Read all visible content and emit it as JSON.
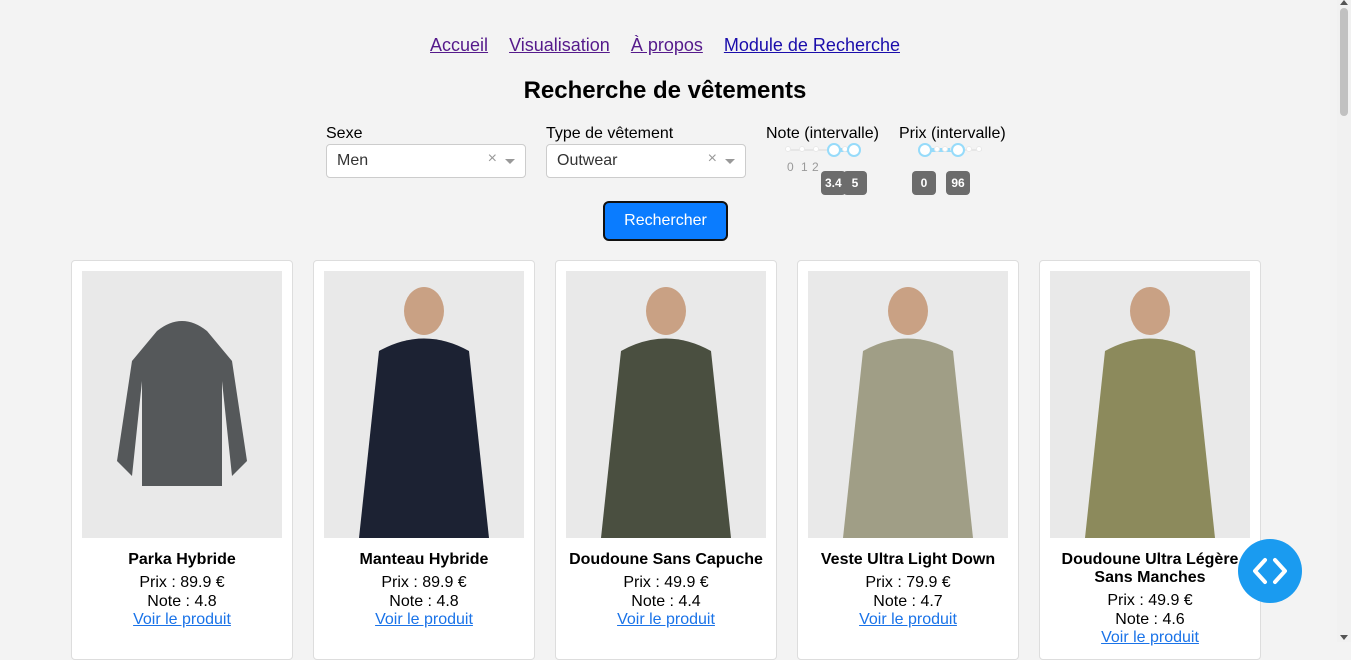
{
  "nav": [
    "Accueil",
    "Visualisation",
    "À propos",
    "Module de Recherche"
  ],
  "title": "Recherche de vêtements",
  "filters": {
    "sexe": {
      "label": "Sexe",
      "value": "Men"
    },
    "type": {
      "label": "Type de vêtement",
      "value": "Outwear"
    },
    "note": {
      "label": "Note (intervalle)",
      "marks": [
        "0",
        "1",
        "2"
      ],
      "low": "3.4",
      "high": "5",
      "range": [
        0,
        5
      ]
    },
    "prix": {
      "label": "Prix (intervalle)",
      "low": "0",
      "high": "96"
    },
    "clear_glyph": "×"
  },
  "search_button": "Rechercher",
  "product_labels": {
    "price_prefix": "Prix : ",
    "rating_prefix": "Note : ",
    "link": "Voir le produit"
  },
  "products": [
    {
      "name": "Parka Hybride",
      "price": "89.9 €",
      "rating": "4.8",
      "colour": "#55585a"
    },
    {
      "name": "Manteau Hybride",
      "price": "89.9 €",
      "rating": "4.8",
      "colour": "#1c2233"
    },
    {
      "name": "Doudoune Sans Capuche",
      "price": "49.9 €",
      "rating": "4.4",
      "colour": "#4a4f40"
    },
    {
      "name": "Veste Ultra Light Down",
      "price": "79.9 €",
      "rating": "4.7",
      "colour": "#a09e86"
    },
    {
      "name": "Doudoune Ultra Légère Sans Manches",
      "price": "49.9 €",
      "rating": "4.6",
      "colour": "#8c8a5c"
    }
  ]
}
